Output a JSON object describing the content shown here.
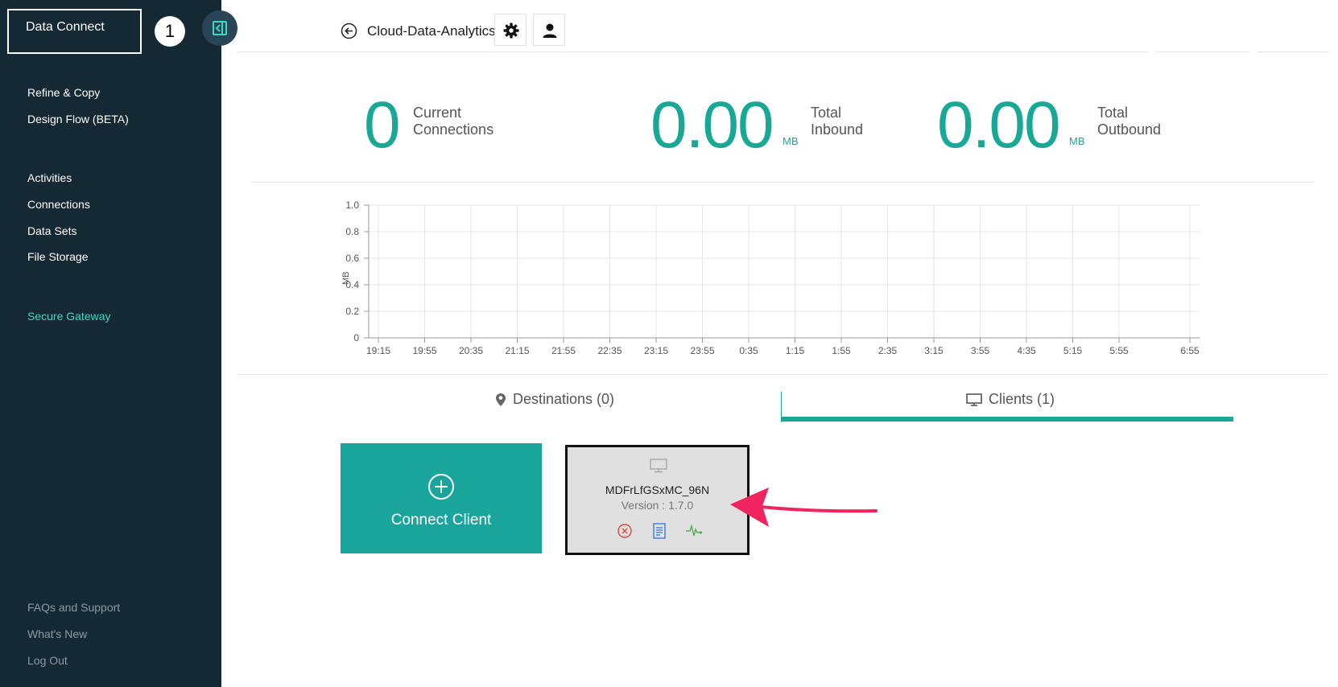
{
  "app": {
    "name": "Data Connect",
    "step_badge": "1"
  },
  "sidebar": {
    "group1": [
      {
        "label": "Refine & Copy"
      },
      {
        "label": "Design Flow (BETA)"
      }
    ],
    "group2": [
      {
        "label": "Activities"
      },
      {
        "label": "Connections"
      },
      {
        "label": "Data Sets"
      },
      {
        "label": "File Storage"
      }
    ],
    "active_item": "Secure Gateway",
    "footer": [
      {
        "label": "FAQs and Support"
      },
      {
        "label": "What's New"
      },
      {
        "label": "Log Out"
      }
    ]
  },
  "header": {
    "title": "Cloud-Data-Analytics",
    "back_icon": "arrow-left-circle-icon",
    "settings_icon": "gear-icon",
    "user_icon": "user-icon"
  },
  "stats": {
    "current": {
      "value": "0",
      "label_line1": "Current",
      "label_line2": "Connections"
    },
    "inbound": {
      "value": "0.00",
      "unit": "MB",
      "label_line1": "Total",
      "label_line2": "Inbound"
    },
    "outbound": {
      "value": "0.00",
      "unit": "MB",
      "label_line1": "Total",
      "label_line2": "Outbound"
    }
  },
  "chart_data": {
    "type": "line",
    "title": "",
    "xlabel": "",
    "ylabel": "MB",
    "ylim": [
      0,
      1.0
    ],
    "y_ticks": [
      "0",
      "0.2",
      "0.4",
      "0.6",
      "0.8",
      "1.0"
    ],
    "x_ticks": [
      "19:15",
      "19:55",
      "20:35",
      "21:15",
      "21:55",
      "22:35",
      "23:15",
      "23:55",
      "0:35",
      "1:15",
      "1:55",
      "2:35",
      "3:15",
      "3:55",
      "4:35",
      "5:15",
      "5:55",
      "6:55"
    ],
    "series": [],
    "grid": true
  },
  "tabs": {
    "destinations": "Destinations (0)",
    "clients": "Clients (1)",
    "active": "clients"
  },
  "connect_client": {
    "label": "Connect Client"
  },
  "client": {
    "name": "MDFrLfGSxMC_96N",
    "version": "Version : 1.7.0"
  },
  "colors": {
    "sidebar": "#152935",
    "accent": "#1aa896",
    "active_nav": "#41d6c3",
    "annotation_arrow": "#f0245f"
  }
}
